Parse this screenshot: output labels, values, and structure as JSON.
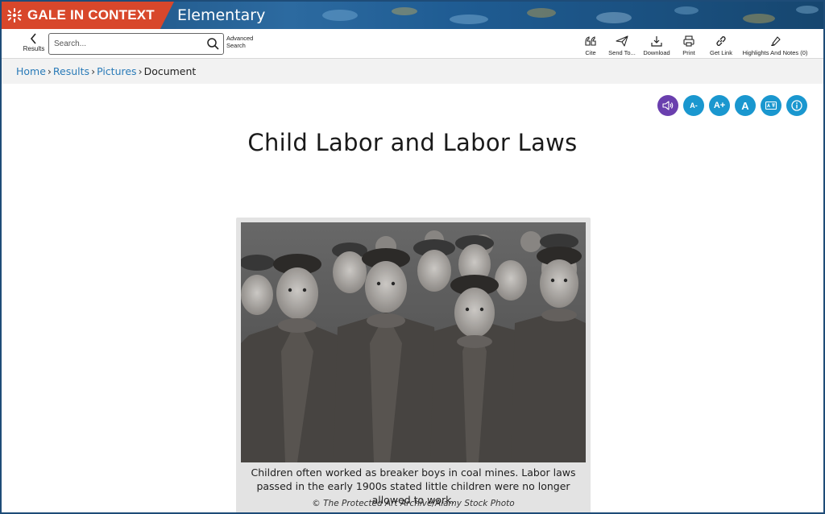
{
  "brand": {
    "name": "GALE IN CONTEXT",
    "product": "Elementary"
  },
  "toolbar": {
    "results_label": "Results",
    "search_placeholder": "Search...",
    "advanced_search_line1": "Advanced",
    "advanced_search_line2": "Search",
    "tools": [
      {
        "label": "Cite",
        "icon": "quote-icon"
      },
      {
        "label": "Send To...",
        "icon": "send-icon"
      },
      {
        "label": "Download",
        "icon": "download-icon"
      },
      {
        "label": "Print",
        "icon": "print-icon"
      },
      {
        "label": "Get Link",
        "icon": "link-icon"
      },
      {
        "label": "Highlights And Notes (0)",
        "icon": "highlighter-icon"
      }
    ]
  },
  "breadcrumb": {
    "home": "Home",
    "results": "Results",
    "pictures": "Pictures",
    "current": "Document",
    "separator": "›"
  },
  "reading_tools": [
    {
      "name": "listen",
      "icon": "speaker-icon",
      "color": "#6a3fae"
    },
    {
      "name": "decrease-text",
      "label": "A-",
      "icon": "text-decrease-icon",
      "color": "#1a97cf"
    },
    {
      "name": "increase-text",
      "label": "A+",
      "icon": "text-increase-icon",
      "color": "#1a97cf"
    },
    {
      "name": "font-style",
      "label": "A",
      "icon": "font-style-icon",
      "color": "#1a97cf"
    },
    {
      "name": "translate",
      "icon": "translate-icon",
      "color": "#1a97cf"
    },
    {
      "name": "info",
      "icon": "info-icon",
      "color": "#1a97cf"
    }
  ],
  "document": {
    "title": "Child Labor and Labor Laws",
    "caption": "Children often worked as breaker boys in coal mines. Labor laws passed in the early 1900s stated little children were no longer allowed to work.",
    "credit": "© The Protected Art Archive/Alamy Stock Photo"
  },
  "colors": {
    "brand_red": "#d8472b",
    "banner_blue": "#1f5c93",
    "link_blue": "#2a7bb8",
    "tool_blue": "#1a97cf",
    "audio_purple": "#6a3fae"
  }
}
